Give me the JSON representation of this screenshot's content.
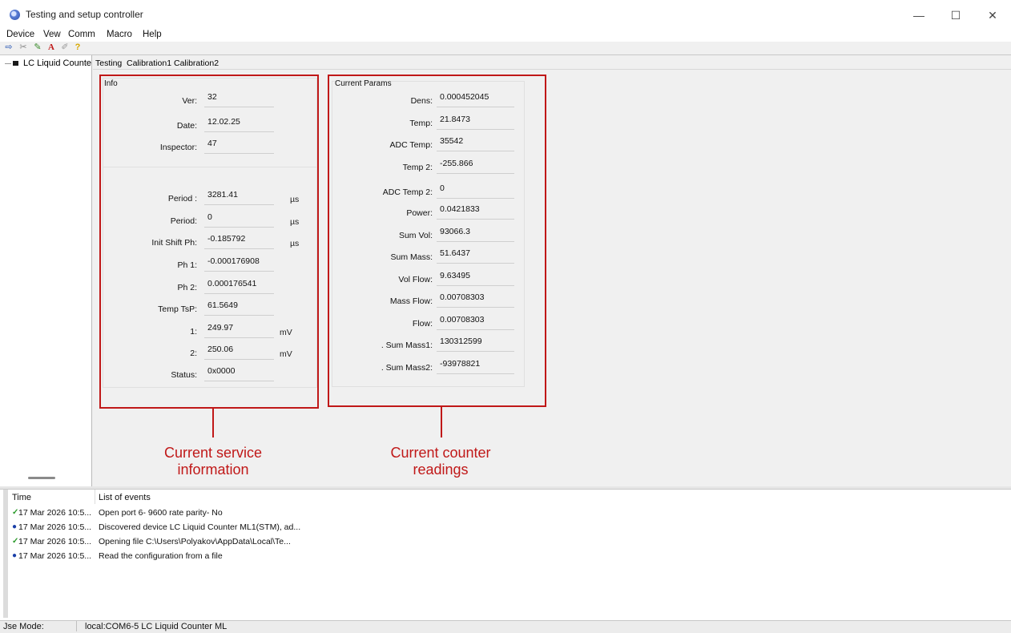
{
  "window": {
    "title": "Testing and setup controller",
    "minimize": "—",
    "maximize": "☐",
    "close": "✕"
  },
  "menu": [
    "Device",
    "Vew",
    "Comm",
    "Macro",
    "Help"
  ],
  "tree": {
    "item": "LC Liquid Counte"
  },
  "tabs": [
    "Testing",
    "Calibration1",
    "Calibration2"
  ],
  "info": {
    "title": "Info",
    "top": [
      {
        "label": "Ver:",
        "value": "32"
      },
      {
        "label": "Date:",
        "value": "12.02.25"
      },
      {
        "label": "Inspector:",
        "value": "47"
      }
    ],
    "bottom": [
      {
        "label": "Period :",
        "value": "3281.41",
        "unit": "µs"
      },
      {
        "label": "Period:",
        "value": "0",
        "unit": "µs"
      },
      {
        "label": "Init Shift Ph:",
        "value": "-0.185792",
        "unit": "µs"
      },
      {
        "label": "Ph 1:",
        "value": "-0.000176908",
        "unit": ""
      },
      {
        "label": "Ph 2:",
        "value": "0.000176541",
        "unit": ""
      },
      {
        "label": "Temp TsP:",
        "value": "61.5649",
        "unit": ""
      },
      {
        "label": "1:",
        "value": "249.97",
        "unit": "mV"
      },
      {
        "label": "2:",
        "value": "250.06",
        "unit": "mV"
      },
      {
        "label": "Status:",
        "value": "0x0000",
        "unit": ""
      }
    ]
  },
  "params": {
    "title": "Current Params",
    "rows": [
      {
        "label": "Dens:",
        "value": "0.000452045"
      },
      {
        "label": "Temp:",
        "value": "21.8473"
      },
      {
        "label": "ADC Temp:",
        "value": "35542"
      },
      {
        "label": "Temp 2:",
        "value": "-255.866"
      },
      {
        "label": "ADC Temp 2:",
        "value": "0"
      },
      {
        "label": "Power:",
        "value": "0.0421833"
      },
      {
        "label": "Sum Vol:",
        "value": "93066.3"
      },
      {
        "label": "Sum Mass:",
        "value": "51.6437"
      },
      {
        "label": "Vol Flow:",
        "value": "9.63495"
      },
      {
        "label": "Mass Flow:",
        "value": "0.00708303"
      },
      {
        "label": "Flow:",
        "value": "0.00708303"
      },
      {
        "label": ". Sum Mass1:",
        "value": "130312599"
      },
      {
        "label": ". Sum Mass2:",
        "value": "-93978821"
      }
    ]
  },
  "annotations": {
    "service": [
      "Current service",
      "information"
    ],
    "counter": [
      "Current counter",
      "readings"
    ]
  },
  "log": {
    "col_time": "Time",
    "col_events": "List of events",
    "side_label": "List of events",
    "rows": [
      {
        "icon": "check",
        "time": "17 Mar 2026 10:5...",
        "event": "Open port 6- 9600 rate parity- No"
      },
      {
        "icon": "info",
        "time": "17 Mar 2026 10:5...",
        "event": "Discovered device LC Liquid Counter ML1(STM), ad..."
      },
      {
        "icon": "check",
        "time": "17 Mar 2026 10:5...",
        "event": "Opening file C:\\Users\\Polyakov\\AppData\\Local\\Te..."
      },
      {
        "icon": "info",
        "time": "17 Mar 2026 10:5...",
        "event": "Read the configuration from a file"
      }
    ]
  },
  "status": {
    "mode": "Jse Mode:",
    "connection": "local:COM6-5 LC Liquid Counter ML"
  },
  "colors": {
    "accent_red": "#c01818",
    "check_green": "#2a9a2a",
    "info_blue": "#1a3fa8"
  }
}
